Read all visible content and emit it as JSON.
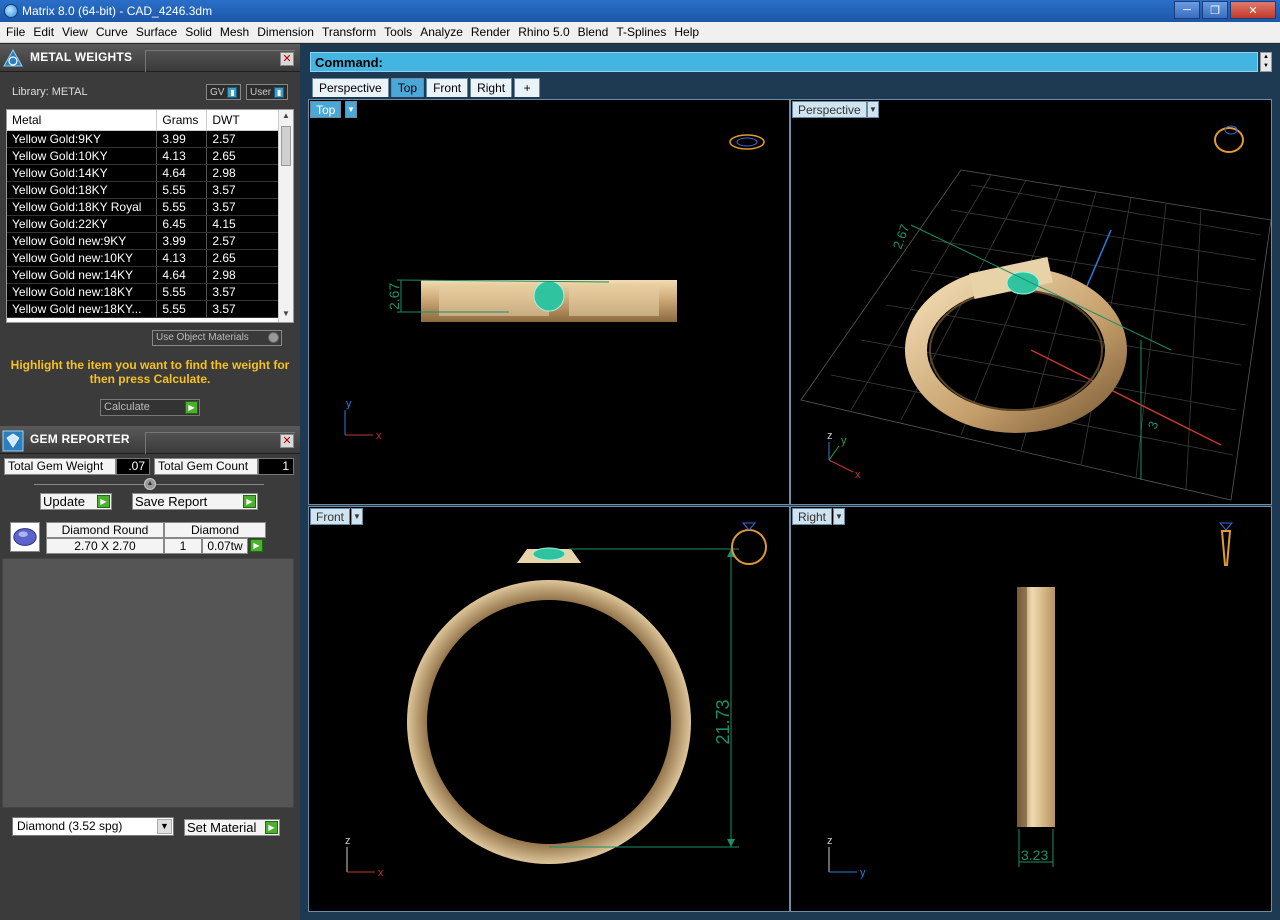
{
  "window": {
    "title": "Matrix 8.0 (64-bit) - CAD_4246.3dm",
    "min_icon": "minimize-icon",
    "max_icon": "maximize-icon",
    "close_icon": "close-icon"
  },
  "menu": [
    "File",
    "Edit",
    "View",
    "Curve",
    "Surface",
    "Solid",
    "Mesh",
    "Dimension",
    "Transform",
    "Tools",
    "Analyze",
    "Render",
    "Rhino 5.0",
    "Blend",
    "T-Splines",
    "Help"
  ],
  "metal_weights": {
    "title": "METAL WEIGHTS",
    "library_label": "Library: METAL",
    "gv_label": "GV",
    "user_label": "User",
    "columns": [
      "Metal",
      "Grams",
      "DWT"
    ],
    "rows": [
      [
        "Yellow Gold:9KY",
        "3.99",
        "2.57"
      ],
      [
        "Yellow Gold:10KY",
        "4.13",
        "2.65"
      ],
      [
        "Yellow Gold:14KY",
        "4.64",
        "2.98"
      ],
      [
        "Yellow Gold:18KY",
        "5.55",
        "3.57"
      ],
      [
        "Yellow Gold:18KY Royal",
        "5.55",
        "3.57"
      ],
      [
        "Yellow Gold:22KY",
        "6.45",
        "4.15"
      ],
      [
        "Yellow Gold new:9KY",
        "3.99",
        "2.57"
      ],
      [
        "Yellow Gold new:10KY",
        "4.13",
        "2.65"
      ],
      [
        "Yellow Gold new:14KY",
        "4.64",
        "2.98"
      ],
      [
        "Yellow Gold new:18KY",
        "5.55",
        "3.57"
      ],
      [
        "Yellow Gold new:18KY...",
        "5.55",
        "3.57"
      ]
    ],
    "use_object_materials": "Use Object Materials",
    "instructions": "Highlight the item you want to find the weight for then press Calculate.",
    "calculate_label": "Calculate"
  },
  "gem_reporter": {
    "title": "GEM REPORTER",
    "total_weight_label": "Total Gem Weight",
    "total_weight_value": ".07",
    "total_count_label": "Total Gem Count",
    "total_count_value": "1",
    "update_label": "Update",
    "save_report_label": "Save Report",
    "gem_shape": "Diamond Round",
    "gem_type": "Diamond",
    "gem_size": "2.70 X 2.70",
    "gem_count": "1",
    "gem_weight": "0.07tw",
    "material_select": "Diamond      (3.52 spg)",
    "set_material_label": "Set Material"
  },
  "command": {
    "label": "Command:"
  },
  "view_tabs": [
    "Perspective",
    "Top",
    "Front",
    "Right",
    "+"
  ],
  "active_tab": "Top",
  "viewports": {
    "top": {
      "label": "Top",
      "dimension": "2.67"
    },
    "perspective": {
      "label": "Perspective",
      "dimension_a": "2.67",
      "dimension_b": "3"
    },
    "front": {
      "label": "Front",
      "dimension": "21.73"
    },
    "right": {
      "label": "Right",
      "dimension": "3.23"
    }
  },
  "axes": {
    "x": "x",
    "y": "y",
    "z": "z"
  },
  "colors": {
    "accent": "#4aa8d8",
    "gold": "#d7b98a",
    "gem": "#2fc3a0",
    "dimension": "#1b8f6a",
    "instruction": "#f7c21f"
  }
}
